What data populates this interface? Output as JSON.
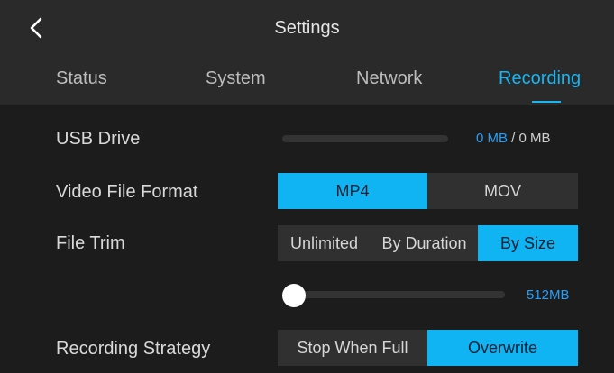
{
  "header": {
    "title": "Settings",
    "back_icon": "chevron-left-icon"
  },
  "tabs": [
    {
      "label": "Status",
      "active": false
    },
    {
      "label": "System",
      "active": false
    },
    {
      "label": "Network",
      "active": false
    },
    {
      "label": "Recording",
      "active": true
    }
  ],
  "settings": {
    "usb_drive": {
      "label": "USB Drive",
      "used": "0 MB",
      "separator": " / ",
      "total": "0 MB",
      "fill_fraction": 0
    },
    "video_file_format": {
      "label": "Video File Format",
      "options": [
        "MP4",
        "MOV"
      ],
      "selected": "MP4"
    },
    "file_trim": {
      "label": "File Trim",
      "options": [
        "Unlimited",
        "By Duration",
        "By Size"
      ],
      "selected": "By Size",
      "size_value": "512MB",
      "slider_fraction": 0
    },
    "recording_strategy": {
      "label": "Recording Strategy",
      "options": [
        "Stop When Full",
        "Overwrite"
      ],
      "selected": "Overwrite"
    }
  },
  "colors": {
    "accent": "#10b4f2",
    "accent_text": "#2a9df4",
    "background": "#1c1c1c",
    "bar": "#2a2a2a"
  }
}
